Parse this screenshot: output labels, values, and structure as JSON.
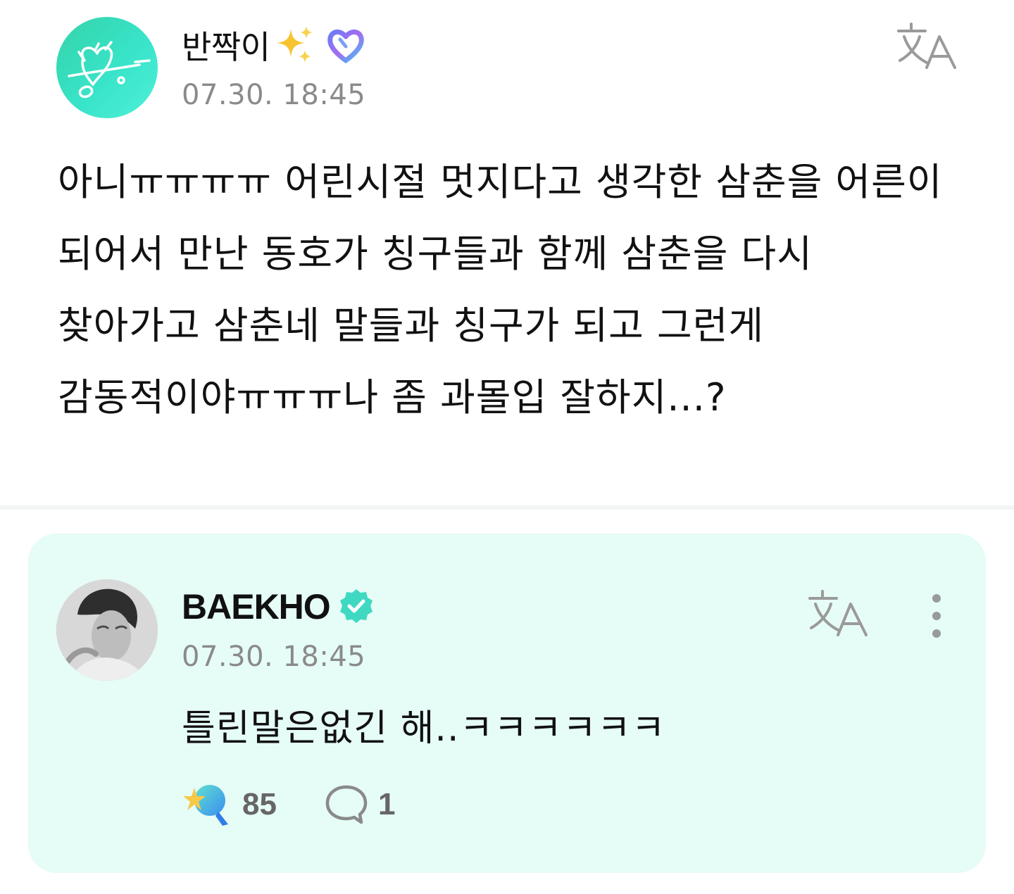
{
  "post": {
    "author": {
      "name": "반짝이",
      "avatar_icon": "signature-heart-logo",
      "badge_icons": [
        "sparkle-icon",
        "membership-icon"
      ]
    },
    "timestamp": "07.30. 18:45",
    "translate_icon": "translate-icon",
    "text": "아니ㅠㅠㅠㅠ 어린시절 멋지다고 생각한 삼춘을 어른이\n되어서 만난 동호가 칭구들과 함께 삼춘을 다시\n찾아가고 삼춘네 말들과 칭구가 되고 그런게\n감동적이야ㅠㅠㅠ나 좀 과몰입 잘하지...?"
  },
  "reply": {
    "author": {
      "name": "BAEKHO",
      "verified_icon": "verified-badge-icon"
    },
    "timestamp": "07.30. 18:45",
    "text": "틀린말은없긴 해..ㅋㅋㅋㅋㅋㅋ",
    "likes": "85",
    "comments": "1",
    "colors": {
      "card_background": "#e6fcf6",
      "accent": "#3fd9c2"
    }
  }
}
